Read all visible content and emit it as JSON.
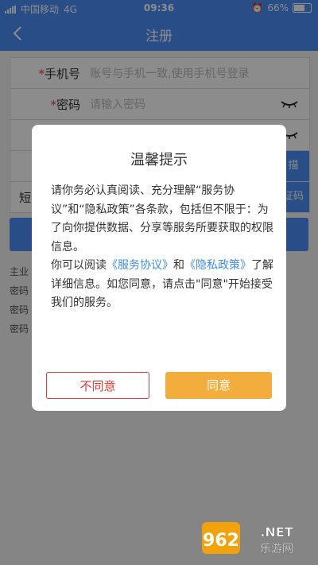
{
  "status_bar": {
    "carrier": "中国移动",
    "network": "4G",
    "time": "09:36",
    "battery": "66%",
    "battery_level": 0.66
  },
  "nav": {
    "title": "注册"
  },
  "form": {
    "phone": {
      "label": "手机号",
      "placeholder": "账号与手机一致,使用手机号登录"
    },
    "password": {
      "label": "密码",
      "placeholder": "请输入密码"
    },
    "scan_fragment": "描",
    "sms_label_fragment": "短",
    "sms_button_fragment": "证码"
  },
  "page_fragments": [
    "主业",
    "密码",
    "密码",
    "密码"
  ],
  "dialog": {
    "title": "温馨提示",
    "para1": "请你务必认真阅读、充分理解“服务协议”和“隐私政策”各条款，包括但不限于：为了向你提供数据、分享等服务所要获取的权限信息。",
    "para2_prefix": "你可以阅读",
    "service_link": "《服务协议》",
    "para2_and": "和",
    "privacy_link": "《隐私政策》",
    "para2_suffix": "了解详细信息。如您同意，请点击\"同意\"开始接受我们的服务。",
    "disagree": "不同意",
    "agree": "同意"
  },
  "watermark": {
    "text": "962.NET",
    "subtext": "乐游网"
  },
  "colors": {
    "primary": "#4c8cf5",
    "danger": "#e53935",
    "accent": "#f2ad3c",
    "link": "#3e8de8"
  }
}
